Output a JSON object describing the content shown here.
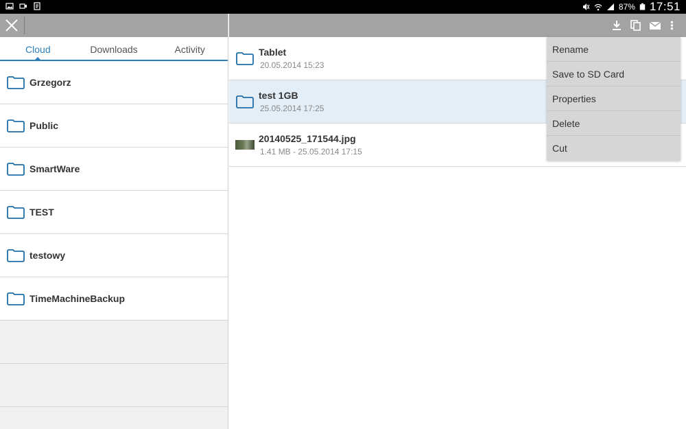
{
  "statusbar": {
    "battery_percent": "87%",
    "time": "17:51"
  },
  "tabs": [
    {
      "label": "Cloud"
    },
    {
      "label": "Downloads"
    },
    {
      "label": "Activity"
    }
  ],
  "folders": [
    {
      "name": "Grzegorz"
    },
    {
      "name": "Public"
    },
    {
      "name": "SmartWare"
    },
    {
      "name": "TEST"
    },
    {
      "name": "testowy"
    },
    {
      "name": "TimeMachineBackup"
    }
  ],
  "files": [
    {
      "name": "Tablet",
      "sub": "20.05.2014 15:23"
    },
    {
      "name": "test 1GB",
      "sub": "25.05.2014 17:25"
    },
    {
      "name": "20140525_171544.jpg",
      "sub": "1.41 MB - 25.05.2014 17:15"
    }
  ],
  "menu": [
    {
      "label": "Rename"
    },
    {
      "label": "Save to SD Card"
    },
    {
      "label": "Properties"
    },
    {
      "label": "Delete"
    },
    {
      "label": "Cut"
    }
  ],
  "colors": {
    "accent": "#2e7fb9",
    "toolbar": "#a3a3a3",
    "selected_row": "#e4eef6",
    "menu_bg": "#d6d6d6"
  },
  "icons": {
    "status_left": [
      "gallery-icon",
      "video-icon",
      "notification-icon"
    ],
    "status_right": [
      "mute-icon",
      "wifi-icon",
      "signal-icon",
      "battery-icon"
    ],
    "toolbar_right": [
      "download-icon",
      "copy-icon",
      "mail-icon",
      "more-vert-icon"
    ]
  }
}
